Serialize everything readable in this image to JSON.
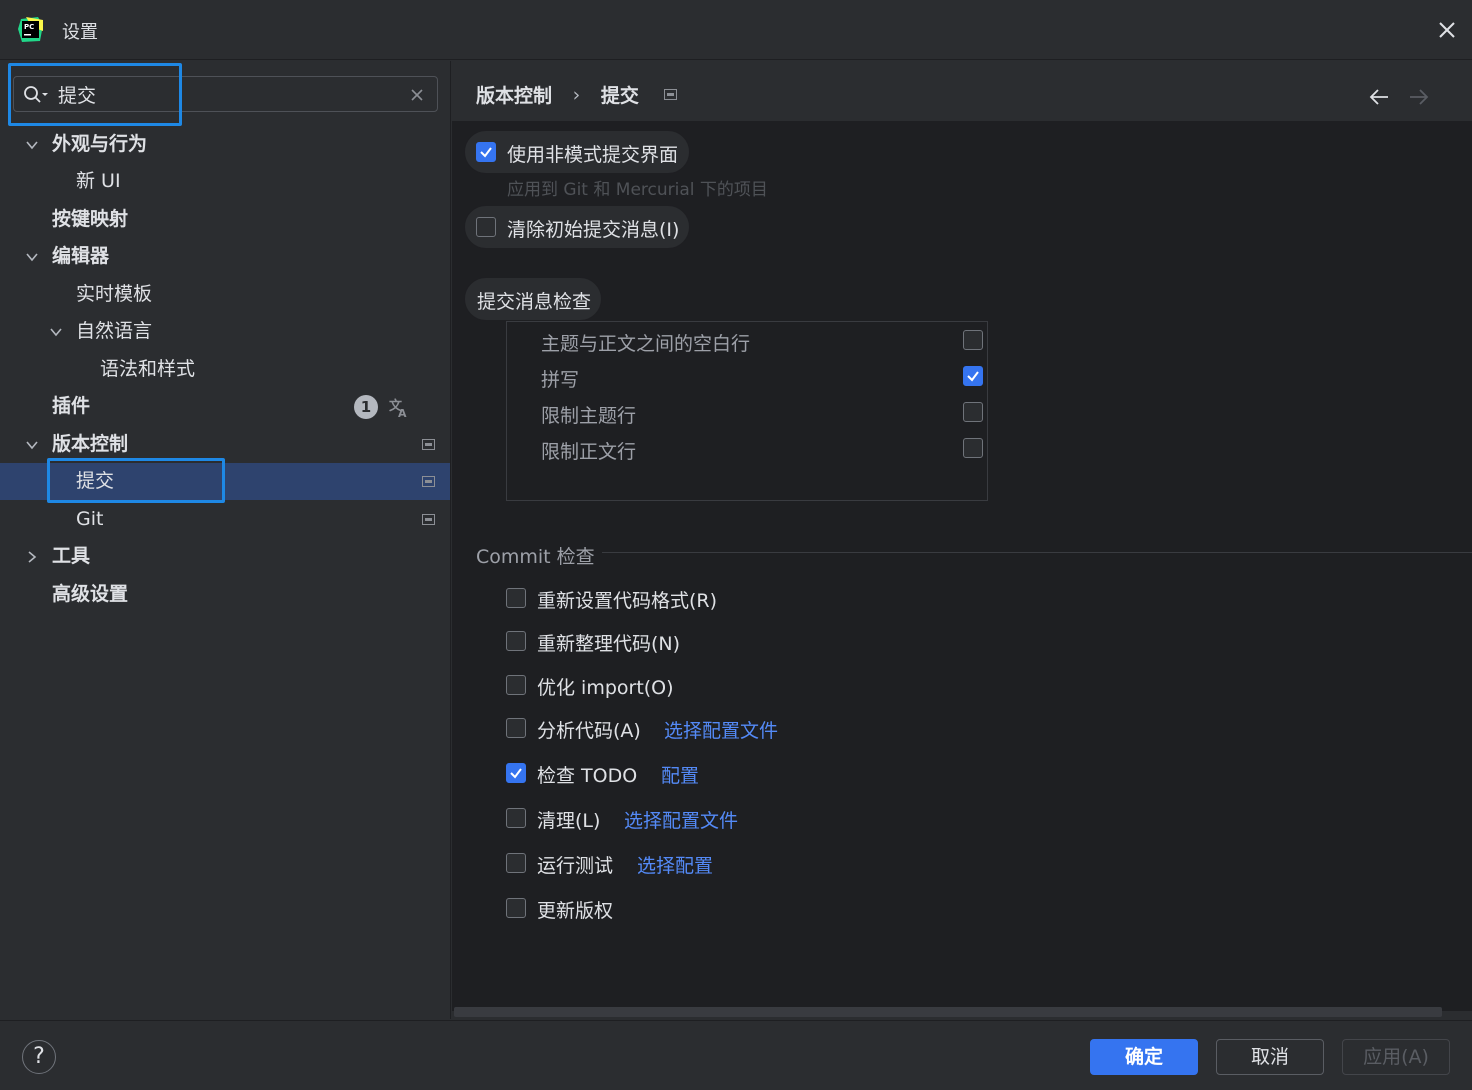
{
  "window": {
    "title": "设置"
  },
  "search": {
    "value": "提交"
  },
  "sidebar": {
    "items": [
      {
        "label": "外观与行为"
      },
      {
        "label": "新 UI"
      },
      {
        "label": "按键映射"
      },
      {
        "label": "编辑器"
      },
      {
        "label": "实时模板"
      },
      {
        "label": "自然语言"
      },
      {
        "label": "语法和样式"
      },
      {
        "label": "插件",
        "badge": "1"
      },
      {
        "label": "版本控制"
      },
      {
        "label": "提交"
      },
      {
        "label": "Git"
      },
      {
        "label": "工具"
      },
      {
        "label": "高级设置"
      }
    ]
  },
  "breadcrumb": {
    "parent": "版本控制",
    "separator": "›",
    "current": "提交"
  },
  "options": {
    "non_modal": {
      "label": "使用非模式提交界面",
      "checked": true,
      "hint": "应用到 Git 和 Mercurial 下的项目"
    },
    "clear_initial": {
      "label": "清除初始提交消息(I)",
      "checked": false
    }
  },
  "message_checks": {
    "title": "提交消息检查",
    "rows": [
      {
        "label": "主题与正文之间的空白行",
        "checked": false
      },
      {
        "label": "拼写",
        "checked": true
      },
      {
        "label": "限制主题行",
        "checked": false
      },
      {
        "label": "限制正文行",
        "checked": false
      }
    ]
  },
  "commit_checks": {
    "title": "Commit 检查",
    "rows": [
      {
        "label": "重新设置代码格式(R)",
        "checked": false,
        "link": ""
      },
      {
        "label": "重新整理代码(N)",
        "checked": false,
        "link": ""
      },
      {
        "label": "优化 import(O)",
        "checked": false,
        "link": ""
      },
      {
        "label": "分析代码(A)",
        "checked": false,
        "link": "选择配置文件"
      },
      {
        "label": "检查 TODO",
        "checked": true,
        "link": "配置"
      },
      {
        "label": "清理(L)",
        "checked": false,
        "link": "选择配置文件"
      },
      {
        "label": "运行测试",
        "checked": false,
        "link": "选择配置"
      },
      {
        "label": "更新版权",
        "checked": false,
        "link": ""
      }
    ]
  },
  "footer": {
    "help": "?",
    "ok": "确定",
    "cancel": "取消",
    "apply": "应用(A)"
  },
  "colors": {
    "accent": "#3574f0",
    "highlight": "#1e88e5",
    "selected": "#2e436e",
    "link": "#548af7"
  }
}
